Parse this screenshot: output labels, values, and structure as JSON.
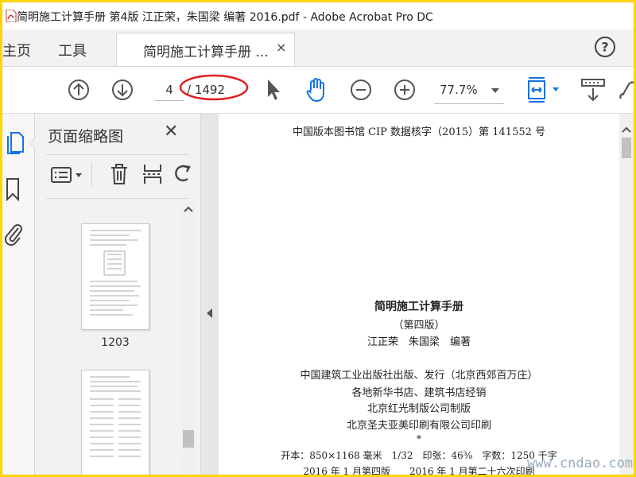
{
  "window": {
    "title": "简明施工计算手册 第4版 江正荣，朱国梁 编著 2016.pdf - Adobe Acrobat Pro DC"
  },
  "menu": {
    "home": "主页",
    "tools": "工具"
  },
  "tab": {
    "label": "简明施工计算手册 ...",
    "close": "×"
  },
  "toolbar": {
    "current_page": "4",
    "total_pages": "/ 1492",
    "zoom": "77.7%"
  },
  "panel": {
    "title": "页面缩略图",
    "close": "✕",
    "thumbs": [
      {
        "label": "1203"
      }
    ]
  },
  "document": {
    "cip": "中国版本图书馆 CIP 数据核字（2015）第 141552 号",
    "book_title": "简明施工计算手册",
    "edition": "（第四版）",
    "authors": "江正荣　朱国梁　编著",
    "publisher": "中国建筑工业出版社出版、发行（北京西郊百万庄）",
    "distributor": "各地新华书店、建筑书店经销",
    "plate_maker": "北京红光制版公司制版",
    "printer": "北京圣夫亚美印刷有限公司印刷",
    "star": "*",
    "specs": "开本：850×1168 毫米　1/32　印张：46⅜　字数：1250 千字",
    "printing": "2016 年 1 月第四版　　2016 年 1 月第二十六次印刷"
  },
  "watermark": "www.cndao.com",
  "colors": {
    "accent": "#1473e6",
    "frame": "#ffd400",
    "annotation": "#e02020"
  }
}
